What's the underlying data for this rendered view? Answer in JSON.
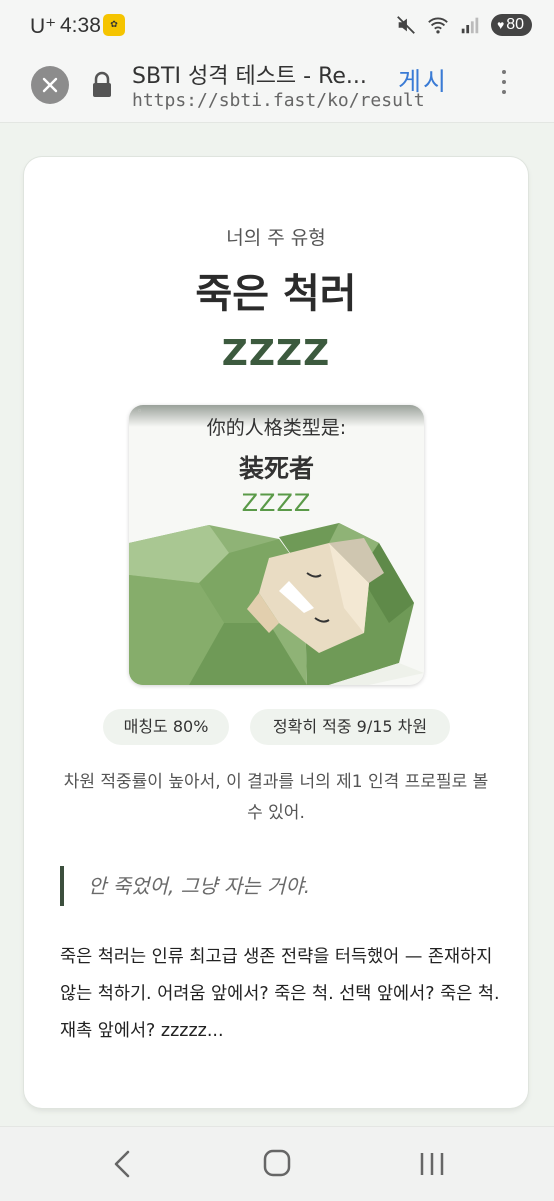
{
  "status_bar": {
    "carrier": "U⁺",
    "time": "4:38",
    "battery": "80"
  },
  "browser": {
    "page_title": "SBTI 성격 테스트 - Re...",
    "url": "https://sbti.fast/ko/result",
    "overlay_annotation": "게시"
  },
  "result": {
    "sub_label": "너의 주 유형",
    "type_name": "죽은 척러",
    "type_code": "ZZZZ",
    "poster": {
      "line1": "你的人格类型是:",
      "line2": "装死者",
      "line3": "ZZZZ"
    },
    "match_pill": "매칭도 80%",
    "hits_pill": "정확히 적중 9/15 차원",
    "description": "차원 적중률이 높아서, 이 결과를 너의 제1 인격 프로필로 볼 수 있어.",
    "quote": "안 죽었어, 그냥 자는 거야.",
    "body": "죽은 척러는 인류 최고급 생존 전략을 터득했어 — 존재하지 않는 척하기. 어려움 앞에서? 죽은 척. 선택 앞에서? 죽은 척. 재촉 앞에서? zzzzz..."
  },
  "icons": {
    "close": "close-icon",
    "lock": "lock-icon",
    "menu": "more-vert-icon",
    "back": "back-icon",
    "home": "home-icon",
    "recents": "recents-icon"
  },
  "colors": {
    "accent_green": "#3c5a3e",
    "poster_green": "#5a9a48",
    "page_bg": "#eff3ee"
  }
}
